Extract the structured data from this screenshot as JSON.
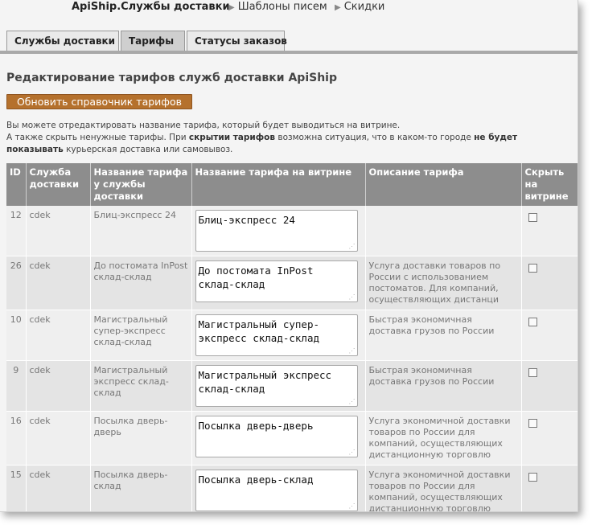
{
  "header": {
    "title": "ApiShip.Службы доставки",
    "links": [
      "Шаблоны писем",
      "Скидки"
    ]
  },
  "tabs": [
    "Службы доставки",
    "Тарифы",
    "Статусы заказов"
  ],
  "page": {
    "heading": "Редактирование тарифов служб доставки ApiShip",
    "refresh_button": "Обновить справочник тарифов",
    "info_line1": "Вы можете отредактировать название тарифа, который будет выводиться на витрине.",
    "info_line2_part1": "А также скрыть ненужные тарифы. При ",
    "info_line2_bold1": "скрытии тарифов",
    "info_line2_part2": " возможна ситуация, что в каком-то городе ",
    "info_line2_bold2": "не будет",
    "info_line3_bold": "показывать",
    "info_line3_part": " курьерская доставка или самовывоз."
  },
  "table": {
    "columns": [
      "ID",
      "Служба доставки",
      "Название тарифа у службы доставки",
      "Название тарифа на витрине",
      "Описание тарифа",
      "Скрыть на витрине"
    ],
    "rows": [
      {
        "id": "12",
        "service": "cdek",
        "tariff": "Блиц-экспресс 24",
        "display": "Блиц-экспресс 24",
        "description": "",
        "hidden": false
      },
      {
        "id": "26",
        "service": "cdek",
        "tariff": "До постомата InPost склад-склад",
        "display": "До постомата InPost склад-склад",
        "description": "Услуга доставки товаров по России с использованием постоматов. Для компаний, осуществляющих дистанци",
        "hidden": false
      },
      {
        "id": "10",
        "service": "cdek",
        "tariff": "Магистральный супер-экспресс склад-склад",
        "display": "Магистральный супер-экспресс склад-склад",
        "description": "Быстрая экономичная доставка грузов по России",
        "hidden": false
      },
      {
        "id": "9",
        "service": "cdek",
        "tariff": "Магистральный экспресс склад-склад",
        "display": "Магистральный экспресс склад-склад",
        "description": "Быстрая экономичная доставка грузов по России",
        "hidden": false
      },
      {
        "id": "16",
        "service": "cdek",
        "tariff": "Посылка дверь-дверь",
        "display": "Посылка дверь-дверь",
        "description": "Услуга экономичной доставки товаров по России для компаний, осуществляющих дистанционную торговлю",
        "hidden": false
      },
      {
        "id": "15",
        "service": "cdek",
        "tariff": "Посылка дверь-склад",
        "display": "Посылка дверь-склад",
        "description": "Услуга экономичной доставки товаров по России для компаний, осуществляющих дистанционную торговлю",
        "hidden": false
      }
    ]
  },
  "colors": {
    "header_bg": "#8d8d8d",
    "button_bg": "#b5712d",
    "row_odd": "#efefef",
    "row_even": "#e4e4e4"
  }
}
